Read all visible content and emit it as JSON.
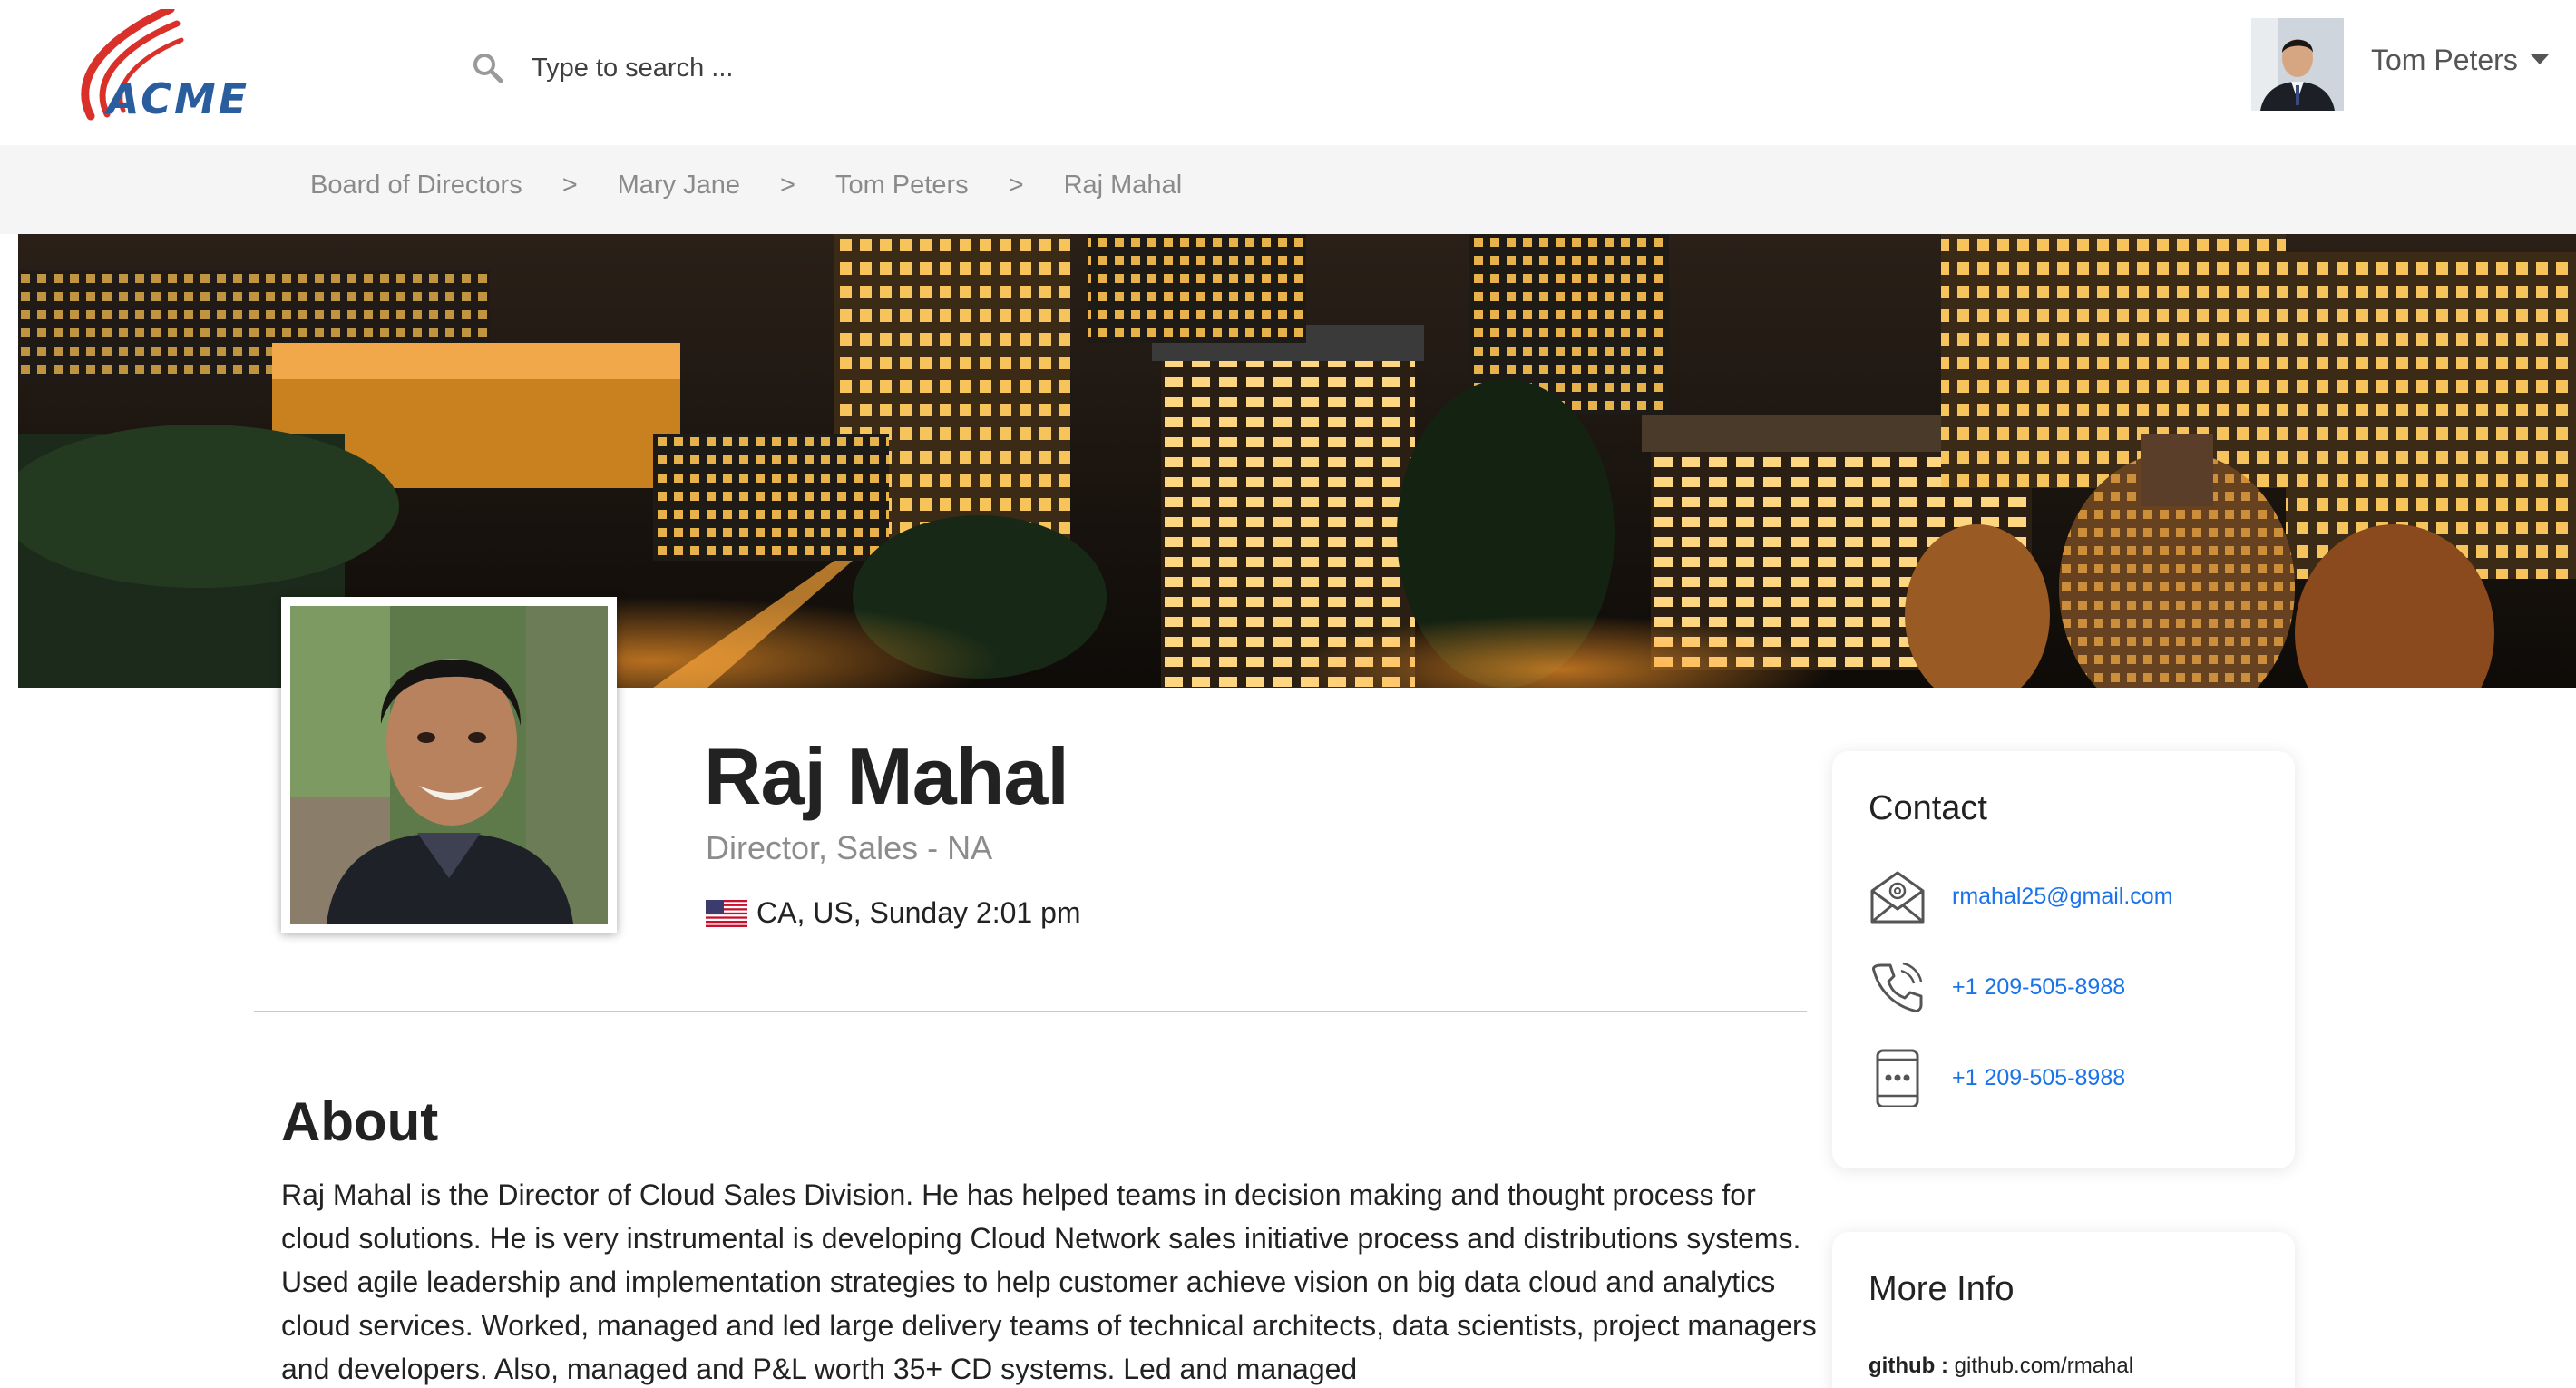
{
  "header": {
    "logo_text": "ACME",
    "search": {
      "placeholder": "Type to search ..."
    },
    "user": {
      "name": "Tom Peters"
    }
  },
  "breadcrumb": {
    "items": [
      "Board of Directors",
      "Mary Jane",
      "Tom Peters",
      "Raj Mahal"
    ],
    "separator": ">"
  },
  "profile": {
    "name": "Raj Mahal",
    "title": "Director, Sales - NA",
    "location": "CA, US, Sunday 2:01 pm"
  },
  "about": {
    "heading": "About",
    "text": "Raj Mahal is the Director of Cloud Sales Division. He has helped teams in decision making and thought process for cloud solutions. He is very instrumental is developing Cloud Network sales initiative process and distributions systems. Used agile leadership and implementation strategies to help customer achieve vision on big data cloud and analytics cloud services. Worked, managed and led large delivery teams of technical architects, data scientists, project managers and developers. Also, managed and P&L worth 35+ CD systems. Led and managed"
  },
  "contact": {
    "title": "Contact",
    "email": "rmahal25@gmail.com",
    "phone": "+1 209-505-8988",
    "mobile": "+1 209-505-8988"
  },
  "more_info": {
    "title": "More Info",
    "github_key": "github :",
    "github_value": "github.com/rmahal"
  },
  "colors": {
    "link": "#1a73e8",
    "logo_red": "#d9302a",
    "logo_blue": "#2a5d9e"
  }
}
